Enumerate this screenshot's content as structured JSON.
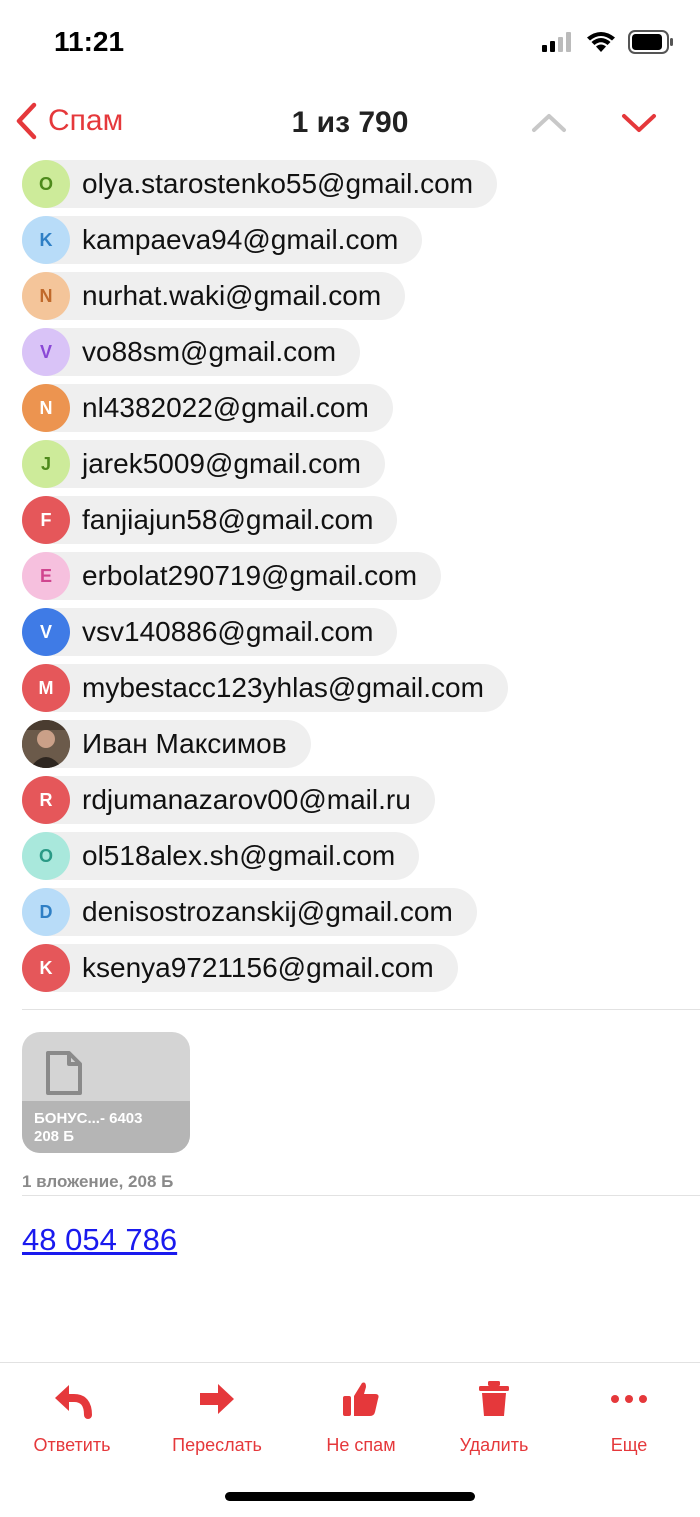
{
  "status": {
    "time": "11:21"
  },
  "nav": {
    "back_label": "Спам",
    "title": "1 из 790"
  },
  "recipients": [
    {
      "letter": "O",
      "text": "olya.starostenko55@gmail.com",
      "bg": "#cdeb9a",
      "fg": "#4e8a1c"
    },
    {
      "letter": "K",
      "text": "kampaeva94@gmail.com",
      "bg": "#b8dcf8",
      "fg": "#2e7fc5"
    },
    {
      "letter": "N",
      "text": "nurhat.waki@gmail.com",
      "bg": "#f4c59a",
      "fg": "#c0692a"
    },
    {
      "letter": "V",
      "text": "vo88sm@gmail.com",
      "bg": "#d9c3f7",
      "fg": "#8a48d6"
    },
    {
      "letter": "N",
      "text": "nl4382022@gmail.com",
      "bg": "#ec9450",
      "fg": "#ffffff"
    },
    {
      "letter": "J",
      "text": "jarek5009@gmail.com",
      "bg": "#cdeb9a",
      "fg": "#4e8a1c"
    },
    {
      "letter": "F",
      "text": "fanjiajun58@gmail.com",
      "bg": "#e5575a",
      "fg": "#ffffff"
    },
    {
      "letter": "E",
      "text": "erbolat290719@gmail.com",
      "bg": "#f6c0de",
      "fg": "#d0458f"
    },
    {
      "letter": "V",
      "text": "vsv140886@gmail.com",
      "bg": "#3f7be6",
      "fg": "#ffffff"
    },
    {
      "letter": "M",
      "text": "mybestacc123yhlas@gmail.com",
      "bg": "#e5575a",
      "fg": "#ffffff"
    },
    {
      "letter": "",
      "text": "Иван Максимов",
      "bg": "#5b4b3e",
      "fg": "#ffffff",
      "photo": true
    },
    {
      "letter": "R",
      "text": "rdjumanazarov00@mail.ru",
      "bg": "#e5575a",
      "fg": "#ffffff"
    },
    {
      "letter": "O",
      "text": "ol518alex.sh@gmail.com",
      "bg": "#a9e8dc",
      "fg": "#2a9a86"
    },
    {
      "letter": "D",
      "text": "denisostrozanskij@gmail.com",
      "bg": "#b8dcf8",
      "fg": "#2e7fc5"
    },
    {
      "letter": "K",
      "text": "ksenya9721156@gmail.com",
      "bg": "#e5575a",
      "fg": "#ffffff"
    }
  ],
  "attachment": {
    "name": "БОНУС...- 6403",
    "size": "208 Б"
  },
  "attachment_summary": "1 вложение, 208 Б",
  "body_link": "48 054 786",
  "toolbar": {
    "reply": "Ответить",
    "forward": "Переслать",
    "not_spam": "Не спам",
    "delete": "Удалить",
    "more": "Еще"
  },
  "colors": {
    "accent": "#e5383b",
    "link": "#1a1aee"
  }
}
